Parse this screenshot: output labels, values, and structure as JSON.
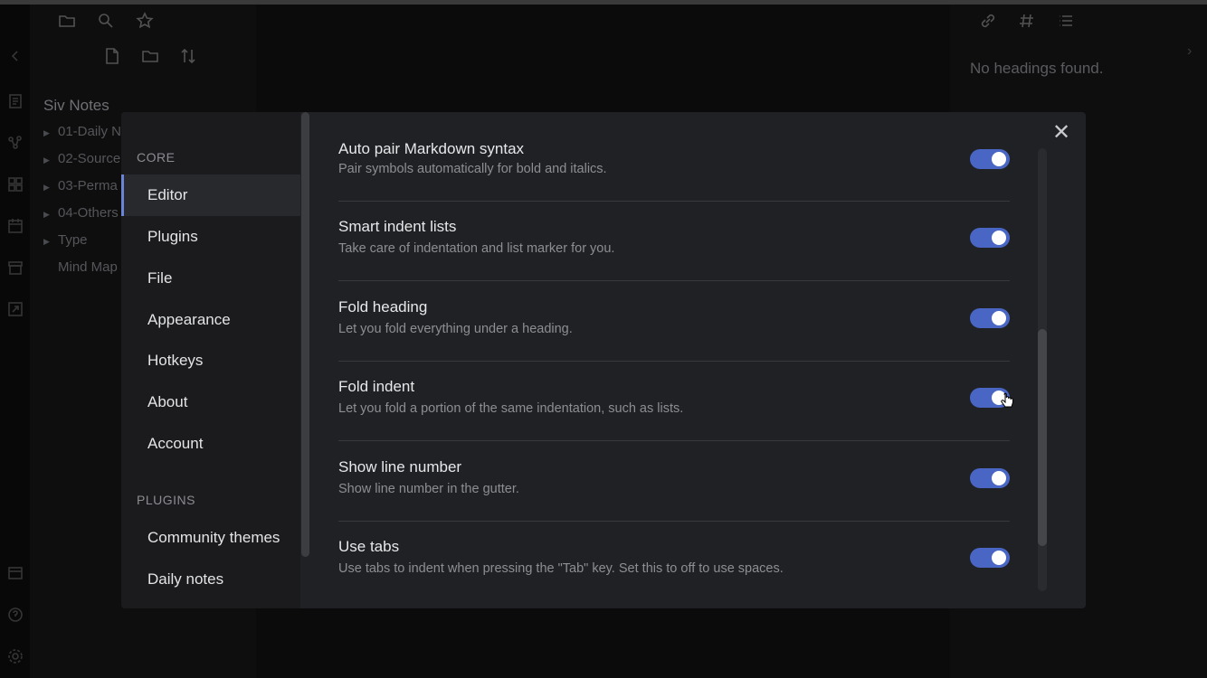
{
  "file_explorer": {
    "vault_name": "Siv Notes",
    "items": [
      {
        "label": "01-Daily N",
        "has_arrow": true
      },
      {
        "label": "02-Source",
        "has_arrow": true
      },
      {
        "label": "03-Perma",
        "has_arrow": true
      },
      {
        "label": "04-Others",
        "has_arrow": true
      },
      {
        "label": "Type",
        "has_arrow": true
      },
      {
        "label": "Mind Map",
        "has_arrow": false
      }
    ]
  },
  "outline": {
    "empty_text": "No headings found."
  },
  "settings": {
    "nav": {
      "core_heading": "CORE",
      "core_items": [
        "Editor",
        "Plugins",
        "File",
        "Appearance",
        "Hotkeys",
        "About",
        "Account"
      ],
      "active": "Editor",
      "plugins_heading": "PLUGINS",
      "plugin_items": [
        "Community themes",
        "Daily notes"
      ]
    },
    "close_label": "✕",
    "options": [
      {
        "name": "Auto pair Markdown syntax",
        "desc": "Pair symbols automatically for bold and italics.",
        "enabled": true
      },
      {
        "name": "Smart indent lists",
        "desc": "Take care of indentation and list marker for you.",
        "enabled": true
      },
      {
        "name": "Fold heading",
        "desc": "Let you fold everything under a heading.",
        "enabled": true
      },
      {
        "name": "Fold indent",
        "desc": "Let you fold a portion of the same indentation, such as lists.",
        "enabled": true
      },
      {
        "name": "Show line number",
        "desc": "Show line number in the gutter.",
        "enabled": true
      },
      {
        "name": "Use tabs",
        "desc": "Use tabs to indent when pressing the \"Tab\" key. Set this to off to use spaces.",
        "enabled": true
      }
    ]
  },
  "colors": {
    "accent": "#4966c5",
    "modal_bg": "#202124",
    "nav_bg": "#1b1b1d"
  }
}
